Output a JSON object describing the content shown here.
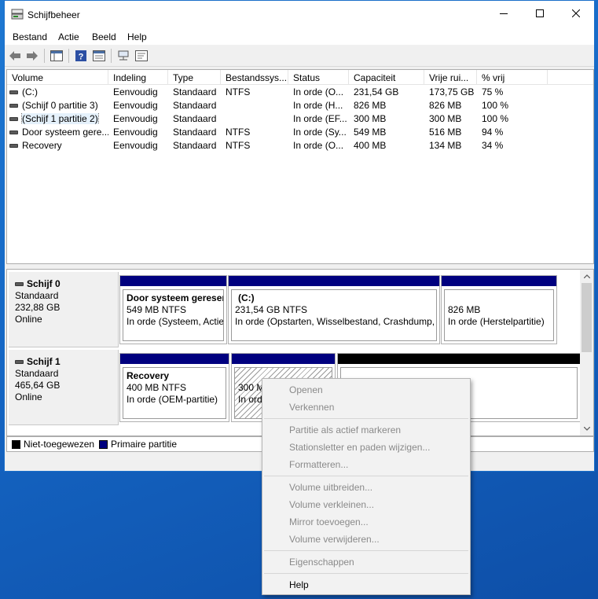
{
  "window": {
    "title": "Schijfbeheer",
    "icon": "disk-management-icon",
    "controls": [
      "minimize-icon",
      "maximize-icon",
      "close-icon"
    ]
  },
  "menu": {
    "items": [
      {
        "label": "Bestand"
      },
      {
        "label": "Actie"
      },
      {
        "label": "Beeld"
      },
      {
        "label": "Help"
      }
    ]
  },
  "toolbar": {
    "icons": [
      "back-arrow-icon",
      "forward-arrow-icon",
      "show-hide-console-tree-icon",
      "help-icon",
      "properties-icon",
      "connect-icon",
      "refresh-icon"
    ]
  },
  "volumes": {
    "columns": [
      "Volume",
      "Indeling",
      "Type",
      "Bestandssys...",
      "Status",
      "Capaciteit",
      "Vrije rui...",
      "% vrij"
    ],
    "rows": [
      {
        "volume": "(C:)",
        "layout": "Eenvoudig",
        "type": "Standaard",
        "fs": "NTFS",
        "status": "In orde (O...",
        "capacity": "231,54 GB",
        "free": "173,75 GB",
        "pct": "75 %"
      },
      {
        "volume": "(Schijf 0 partitie 3)",
        "layout": "Eenvoudig",
        "type": "Standaard",
        "fs": "",
        "status": "In orde (H...",
        "capacity": "826 MB",
        "free": "826 MB",
        "pct": "100 %"
      },
      {
        "volume": "(Schijf 1 partitie 2)",
        "layout": "Eenvoudig",
        "type": "Standaard",
        "fs": "",
        "status": "In orde (EF...",
        "capacity": "300 MB",
        "free": "300 MB",
        "pct": "100 %"
      },
      {
        "volume": "Door systeem gere...",
        "layout": "Eenvoudig",
        "type": "Standaard",
        "fs": "NTFS",
        "status": "In orde (Sy...",
        "capacity": "549 MB",
        "free": "516 MB",
        "pct": "94 %"
      },
      {
        "volume": "Recovery",
        "layout": "Eenvoudig",
        "type": "Standaard",
        "fs": "NTFS",
        "status": "In orde (O...",
        "capacity": "400 MB",
        "free": "134 MB",
        "pct": "34 %"
      }
    ]
  },
  "disks": [
    {
      "name": "Schijf 0",
      "kind": "Standaard",
      "size": "232,88 GB",
      "state": "Online",
      "partitions": [
        {
          "title": "Door systeem gereser",
          "size": "549 MB NTFS",
          "status": "In orde (Systeem, Actie"
        },
        {
          "title": "(C:)",
          "size": "231,54 GB NTFS",
          "status": "In orde (Opstarten, Wisselbestand, Crashdump, P"
        },
        {
          "title": "",
          "size": "826 MB",
          "status": "In orde (Herstelpartitie)"
        }
      ]
    },
    {
      "name": "Schijf 1",
      "kind": "Standaard",
      "size": "465,64 GB",
      "state": "Online",
      "partitions": [
        {
          "title": "Recovery",
          "size": "400 MB NTFS",
          "status": "In orde (OEM-partitie)"
        },
        {
          "title": "",
          "size": "300 MB",
          "status": "In orde"
        },
        {
          "title": "",
          "size": "",
          "status": ""
        }
      ]
    }
  ],
  "legend": {
    "items": [
      {
        "label": "Niet-toegewezen",
        "color": "#000000"
      },
      {
        "label": "Primaire partitie",
        "color": "#00007f"
      }
    ]
  },
  "context_menu": {
    "items": [
      {
        "label": "Openen",
        "enabled": false
      },
      {
        "label": "Verkennen",
        "enabled": false
      },
      {
        "label": "Partitie als actief markeren",
        "enabled": false
      },
      {
        "label": "Stationsletter en paden wijzigen...",
        "enabled": false
      },
      {
        "label": "Formatteren...",
        "enabled": false
      },
      {
        "label": "Volume uitbreiden...",
        "enabled": false
      },
      {
        "label": "Volume verkleinen...",
        "enabled": false
      },
      {
        "label": "Mirror toevoegen...",
        "enabled": false
      },
      {
        "label": "Volume verwijderen...",
        "enabled": false
      },
      {
        "label": "Eigenschappen",
        "enabled": false
      },
      {
        "label": "Help",
        "enabled": true
      }
    ]
  }
}
